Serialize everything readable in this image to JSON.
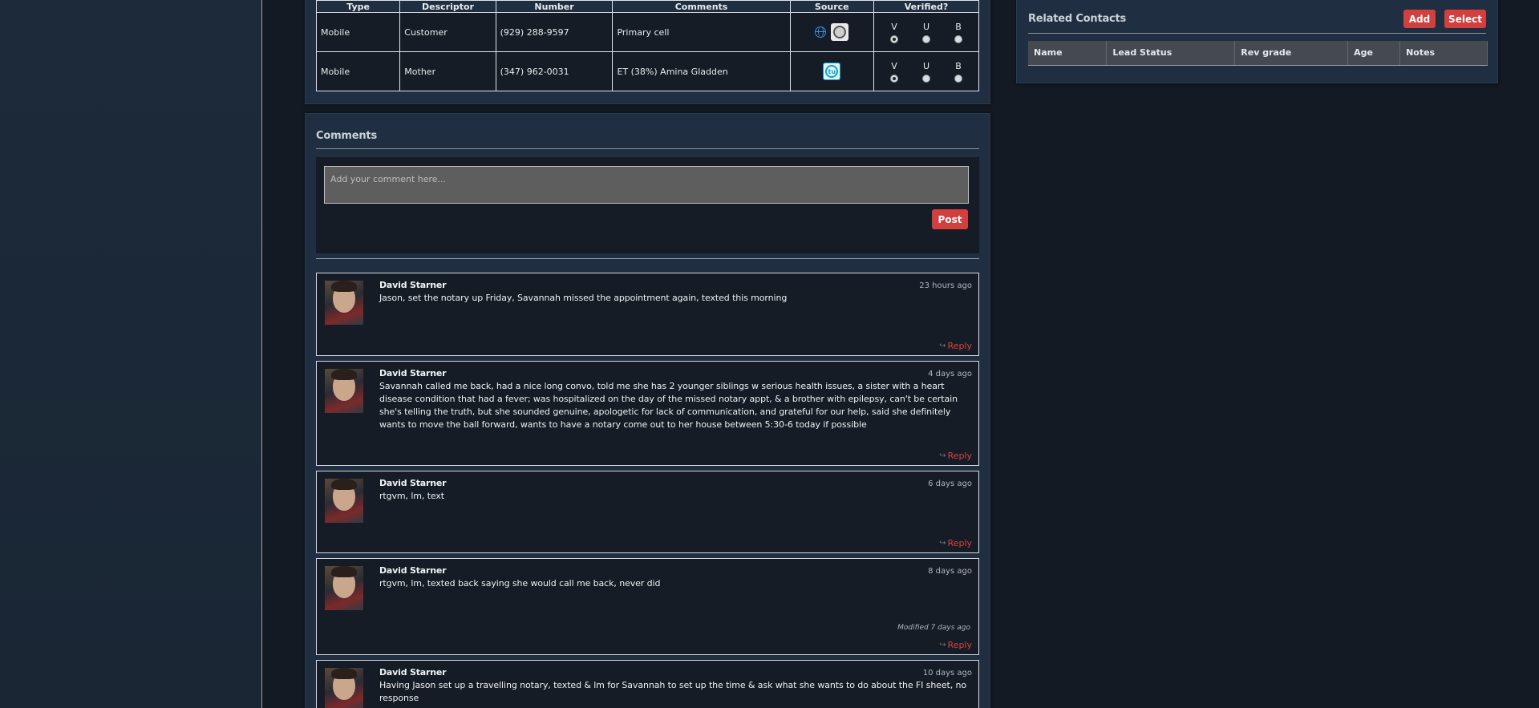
{
  "phones": {
    "headers": {
      "type": "Type",
      "descriptor": "Descriptor",
      "number": "Number",
      "comments": "Comments",
      "source": "Source",
      "verified": "Verified?"
    },
    "verify_labels": {
      "v": "V",
      "u": "U",
      "b": "B"
    },
    "rows": [
      {
        "type": "Mobile",
        "descriptor": "Customer",
        "number": "(929) 288-9597",
        "comments": "Primary cell",
        "sources": [
          "globe-icon",
          "seal-icon"
        ],
        "verified": "V"
      },
      {
        "type": "Mobile",
        "descriptor": "Mother",
        "number": "(347) 962-0031",
        "comments": "ET (38%) Amina Gladden",
        "sources": [
          "tu-icon"
        ],
        "verified": "V"
      }
    ]
  },
  "comments": {
    "title": "Comments",
    "placeholder": "Add your comment here...",
    "post_label": "Post",
    "reply_label": "Reply",
    "items": [
      {
        "author": "David Starner",
        "time": "23 hours ago",
        "text": "Jason, set the notary up Friday, Savannah missed the appointment again, texted this morning",
        "modified": ""
      },
      {
        "author": "David Starner",
        "time": "4 days ago",
        "text": "Savannah called me back, had a nice long convo, told me she has 2 younger siblings w serious health issues, a sister with a heart disease condition that had a fever; was hospitalized on the day of the missed notary appt, & a brother with epilepsy, can't be certain she's telling the truth, but she sounded genuine, apologetic for lack of communication, and grateful for our help, said she definitely wants to move the ball forward, wants to have a notary come out to her house between 5:30-6 today if possible",
        "modified": ""
      },
      {
        "author": "David Starner",
        "time": "6 days ago",
        "text": "rtgvm, lm, text",
        "modified": ""
      },
      {
        "author": "David Starner",
        "time": "8 days ago",
        "text": "rtgvm, lm, texted back saying she would call me back, never did",
        "modified": "Modified 7 days ago"
      },
      {
        "author": "David Starner",
        "time": "10 days ago",
        "text": "Having Jason set up a travelling notary, texted & lm for Savannah to set up the time & ask what she wants to do about the FI sheet, no response",
        "modified": ""
      }
    ]
  },
  "related": {
    "title": "Related Contacts",
    "add_label": "Add",
    "select_label": "Select",
    "columns": [
      "Name",
      "Lead Status",
      "Rev grade",
      "Age",
      "Notes"
    ]
  },
  "colors": {
    "accent": "#d23f3f",
    "panel": "#1f2e40",
    "background": "#131a23"
  }
}
